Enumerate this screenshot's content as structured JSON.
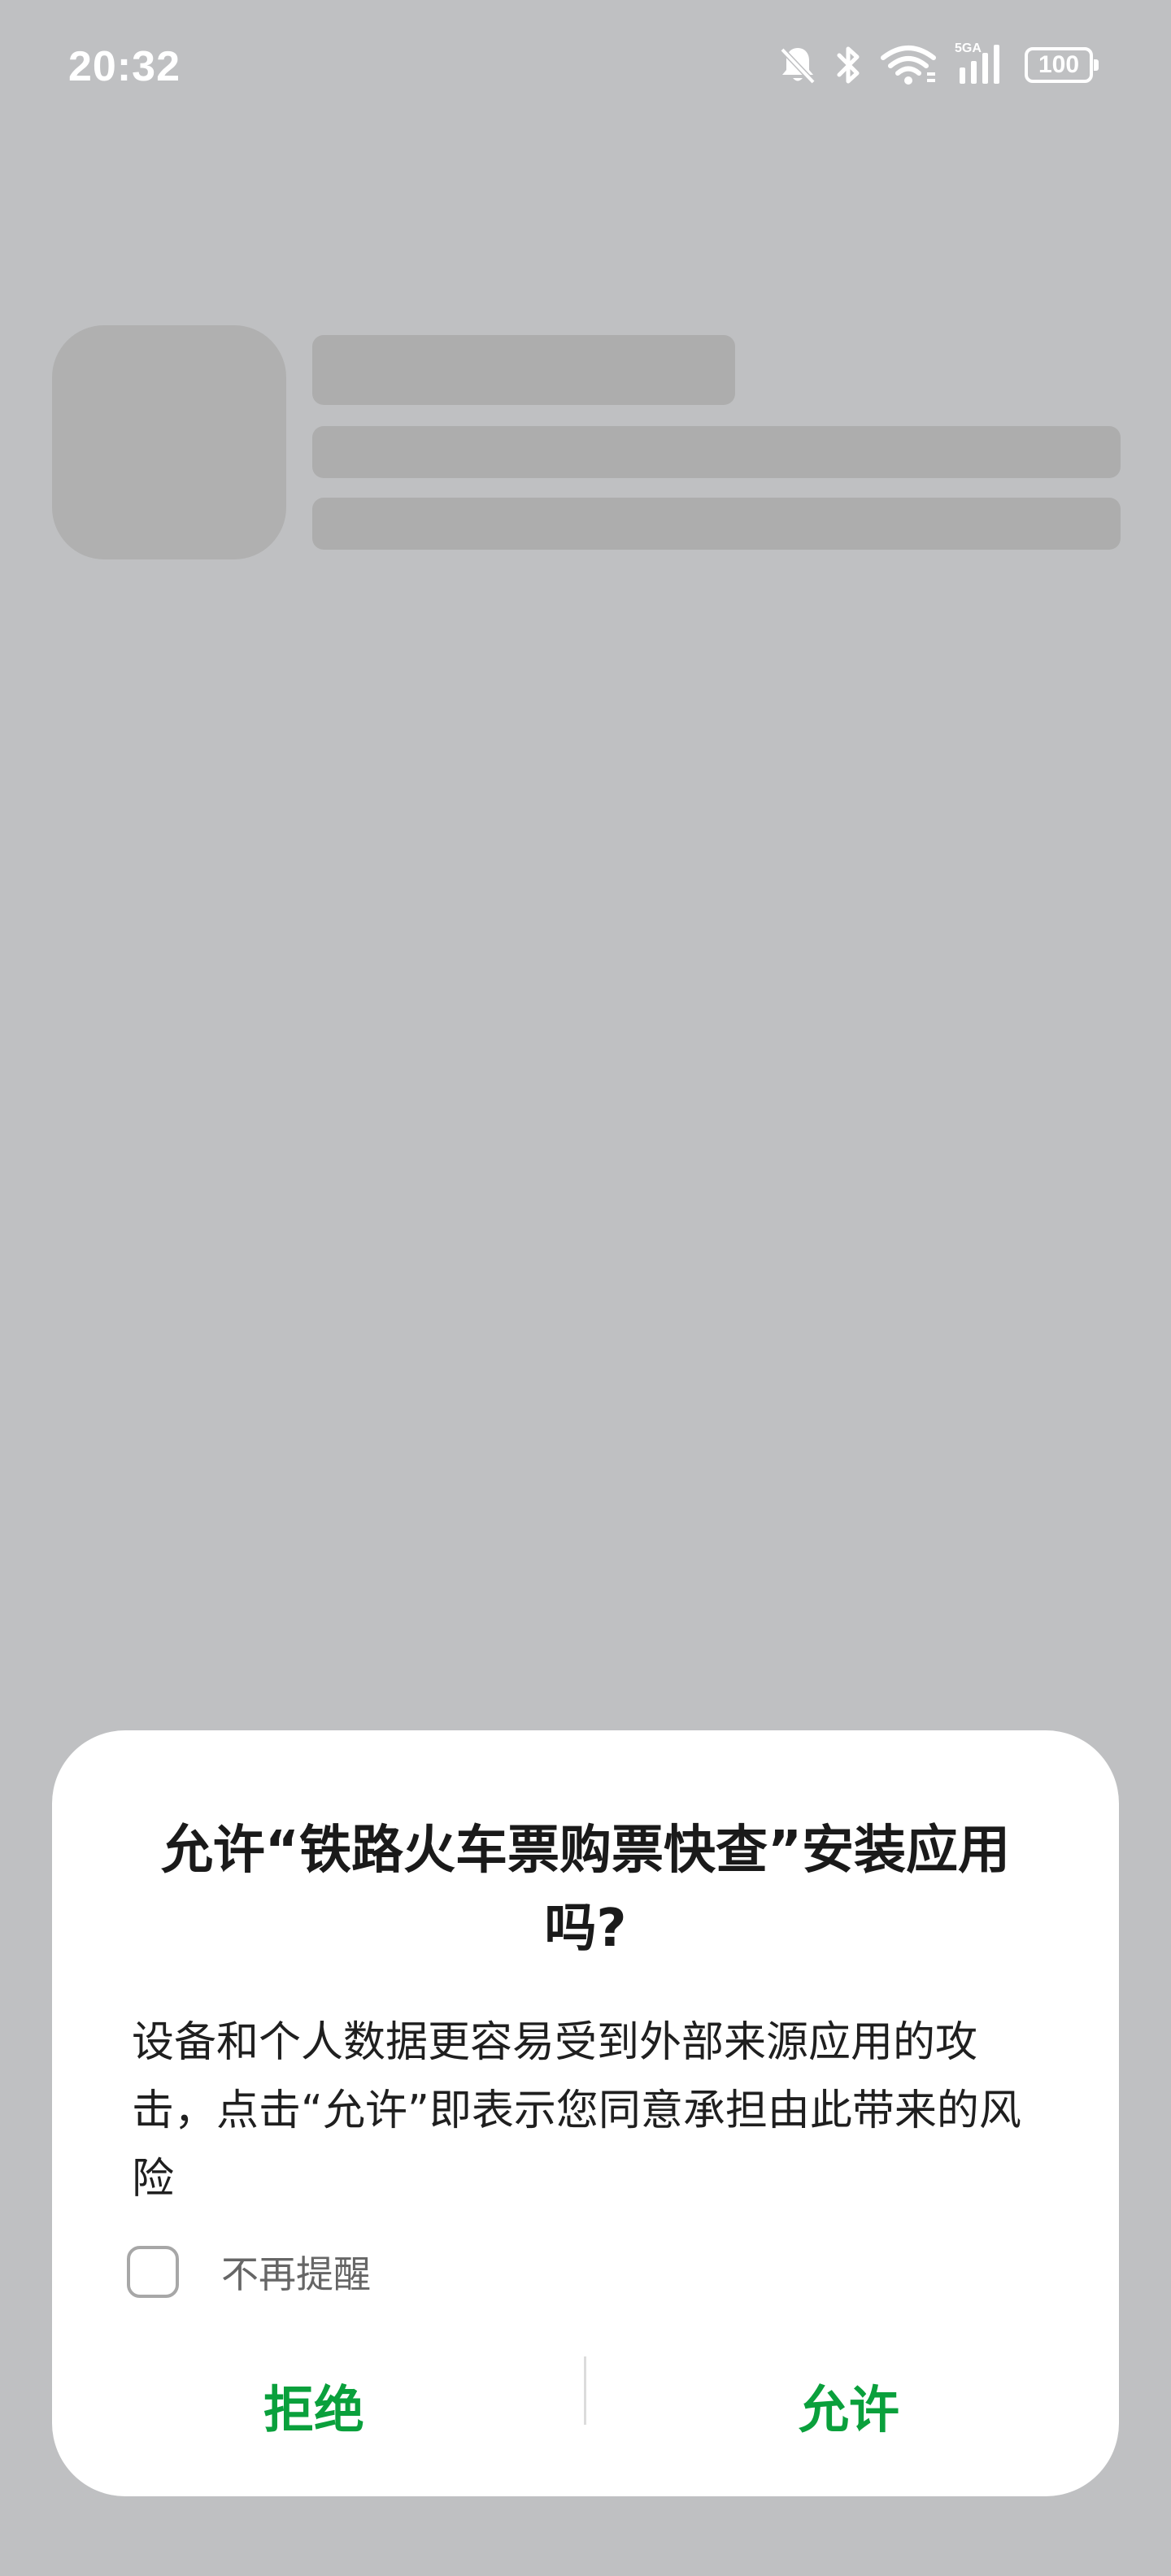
{
  "status_bar": {
    "time": "20:32",
    "icons": [
      "mute-bell-icon",
      "bluetooth-icon",
      "wifi-icon",
      "5ga-signal-icon"
    ],
    "network_label": "5GA",
    "battery_level": "100"
  },
  "dialog": {
    "title": "允许“铁路火车票购票快查”安装应用吗?",
    "message": "设备和个人数据更容易受到外部来源应用的攻击，点击“允许”即表示您同意承担由此带来的风险",
    "checkbox_label": "不再提醒",
    "checkbox_checked": false,
    "deny_label": "拒绝",
    "allow_label": "允许",
    "accent_color": "#0aa03c"
  }
}
